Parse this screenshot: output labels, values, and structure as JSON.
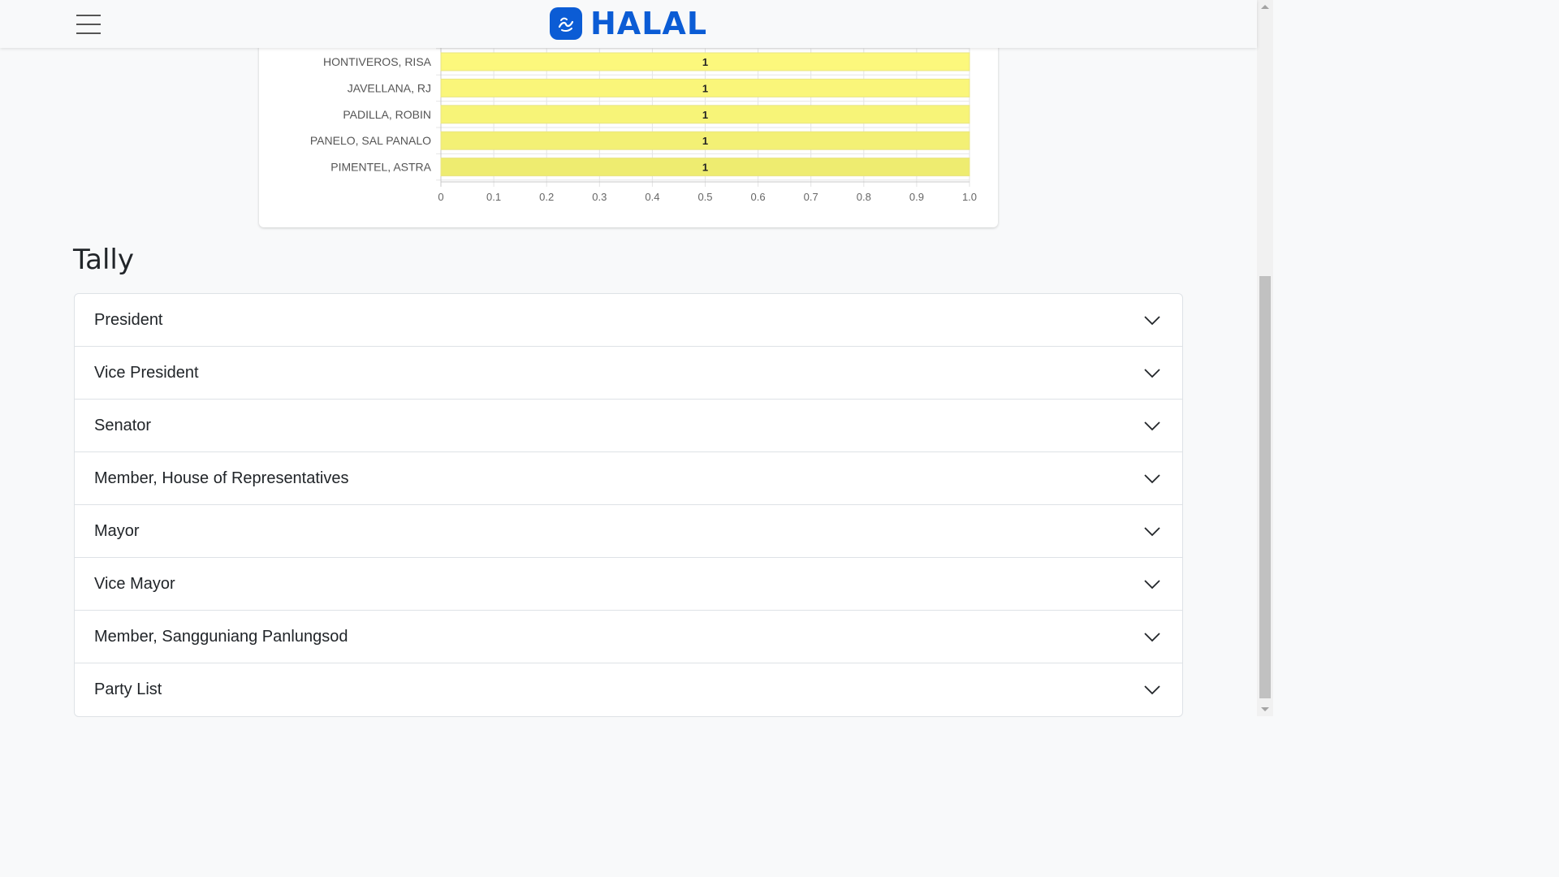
{
  "brand": {
    "name": "HALAL",
    "color": "#0b5cd5",
    "logo_icon": "wave-hand-icon"
  },
  "nav": {
    "menu_icon": "hamburger-menu-icon"
  },
  "chart_data": {
    "type": "bar",
    "orientation": "horizontal",
    "categories": [
      "HONTIVEROS, RISA",
      "JAVELLANA, RJ",
      "PADILLA, ROBIN",
      "PANELO, SAL PANALO",
      "PIMENTEL, ASTRA"
    ],
    "values": [
      1,
      1,
      1,
      1,
      1
    ],
    "data_labels": [
      "1",
      "1",
      "1",
      "1",
      "1"
    ],
    "xlim": [
      0,
      1.0
    ],
    "x_ticks": [
      "0",
      "0.1",
      "0.2",
      "0.3",
      "0.4",
      "0.5",
      "0.6",
      "0.7",
      "0.8",
      "0.9",
      "1.0"
    ],
    "grid": true,
    "bar_colors": [
      "#fcf87c",
      "#faf67a",
      "#f7f478",
      "#f3f075",
      "#eeec70"
    ],
    "bar_stroke": "#e8e486"
  },
  "tally": {
    "title": "Tally",
    "items": [
      {
        "label": "President"
      },
      {
        "label": "Vice President"
      },
      {
        "label": "Senator"
      },
      {
        "label": "Member, House of Representatives"
      },
      {
        "label": "Mayor"
      },
      {
        "label": "Vice Mayor"
      },
      {
        "label": "Member, Sangguniang Panlungsod"
      },
      {
        "label": "Party List"
      }
    ]
  }
}
